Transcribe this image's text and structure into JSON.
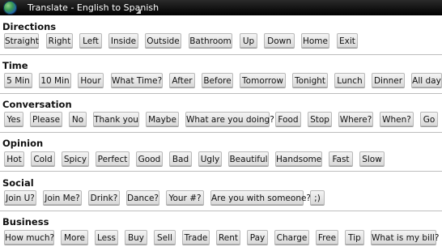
{
  "app": {
    "title": "Translate - English to Spanish"
  },
  "sections": [
    {
      "title": "Directions",
      "buttons": [
        "Straight",
        "Right",
        "Left",
        "Inside",
        "Outside",
        "Bathroom",
        "Up",
        "Down",
        "Home",
        "Exit"
      ]
    },
    {
      "title": "Time",
      "buttons": [
        "5 Min",
        "10 Min",
        "Hour",
        "What Time?",
        "After",
        "Before",
        "Tomorrow",
        "Tonight",
        "Lunch",
        "Dinner",
        "All day"
      ]
    },
    {
      "title": "Conversation",
      "buttons": [
        "Yes",
        "Please",
        "No",
        "Thank you",
        "Maybe",
        "What are you doing?",
        "Food",
        "Stop",
        "Where?",
        "When?",
        "Go"
      ]
    },
    {
      "title": "Opinion",
      "buttons": [
        "Hot",
        "Cold",
        "Spicy",
        "Perfect",
        "Good",
        "Bad",
        "Ugly",
        "Beautiful",
        "Handsome",
        "Fast",
        "Slow"
      ]
    },
    {
      "title": "Social",
      "buttons": [
        "Join U?",
        "Join Me?",
        "Drink?",
        "Dance?",
        "Your #?",
        "Are you with someone?",
        ";)"
      ]
    },
    {
      "title": "Business",
      "buttons": [
        "How much?",
        "More",
        "Less",
        "Buy",
        "Sell",
        "Trade",
        "Rent",
        "Pay",
        "Charge",
        "Free",
        "Tip",
        "What is my bill?"
      ]
    }
  ]
}
